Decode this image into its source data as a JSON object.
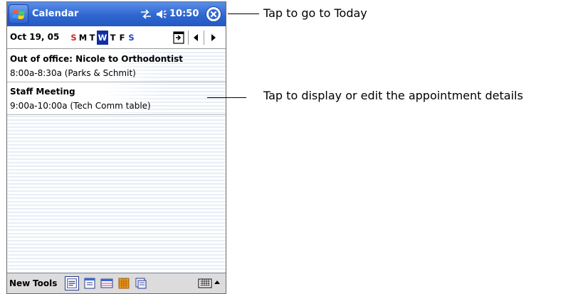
{
  "titlebar": {
    "app_title": "Calendar",
    "clock": "10:50",
    "start_icon": "windows-flag-icon",
    "ok_icon": "close-circle-icon"
  },
  "datebar": {
    "date": "Oct 19, 05",
    "weekdays": [
      "S",
      "M",
      "T",
      "W",
      "T",
      "F",
      "S"
    ],
    "selected_day": "W"
  },
  "appointments": [
    {
      "title": "Out of office: Nicole to Orthodontist",
      "detail": "8:00a-8:30a (Parks & Schmit)"
    },
    {
      "title": "Staff Meeting",
      "detail": "9:00a-10:00a (Tech Comm table)"
    }
  ],
  "cmdbar": {
    "new_label": "New",
    "tools_label": "Tools"
  },
  "callouts": {
    "today": "Tap to go to Today",
    "appointment": "Tap to display or edit the appointment details"
  },
  "colors": {
    "titlebar": "#2f66d0",
    "selected_day_bg": "#1030a0",
    "weekend_sunday": "#d82020",
    "weekend_saturday": "#2045d0"
  }
}
